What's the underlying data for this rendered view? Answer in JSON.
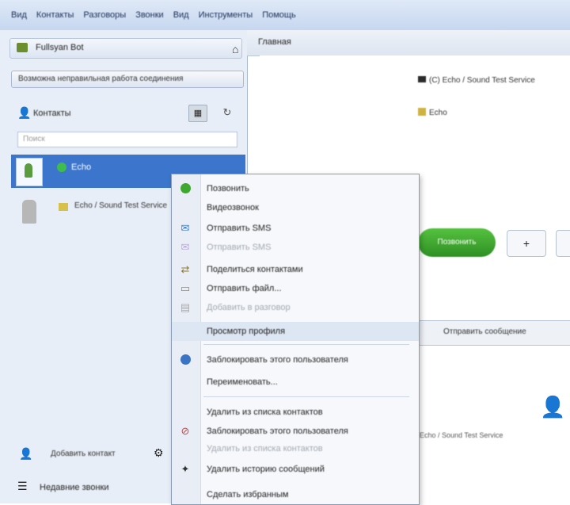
{
  "menubar": {
    "items": [
      "Вид",
      "Контакты",
      "Разговоры",
      "Звонки",
      "Вид",
      "Инструменты",
      "Помощь"
    ]
  },
  "left_panel": {
    "account_label": "Fullsyan Bot",
    "status_text": "Возможна неправильная работа соединения",
    "contacts_label": "Контакты",
    "search_placeholder": "Поиск",
    "selected_contact": "Echo",
    "second_contact": "Echo / Sound Test Service",
    "bottom_item1": "Добавить контакт",
    "bottom_item2": "Недавние звонки"
  },
  "right_panel": {
    "tab_label": "Главная",
    "conv_line1": "(C) Echo / Sound Test Service",
    "conv_line2": "Echo",
    "call_button": "Позвонить",
    "mid_tab": "Отправить сообщение",
    "info_line": "Echo / Sound Test Service"
  },
  "context_menu": {
    "items": [
      {
        "label": "Позвонить",
        "icon": "call-icon",
        "enabled": true
      },
      {
        "label": "Видеозвонок",
        "icon": "",
        "enabled": true
      },
      {
        "label": "Отправить SMS",
        "icon": "sms-icon",
        "enabled": true
      },
      {
        "label": "Отправить SMS",
        "icon": "sms-icon-2",
        "enabled": false
      },
      {
        "label": "Поделиться контактами",
        "icon": "share-icon",
        "enabled": true
      },
      {
        "label": "Отправить файл...",
        "icon": "file-icon",
        "enabled": true
      },
      {
        "label": "Добавить в разговор",
        "icon": "add-icon",
        "enabled": false
      },
      {
        "label": "Просмотр профиля",
        "icon": "",
        "enabled": true,
        "highlighted": true
      },
      {
        "label": "Заблокировать этого пользователя",
        "icon": "block-icon",
        "enabled": true
      },
      {
        "label": "Переименовать...",
        "icon": "",
        "enabled": true
      },
      {
        "label": "Удалить из списка контактов",
        "icon": "",
        "enabled": true
      },
      {
        "label": "Заблокировать этого пользователя",
        "icon": "block-red-icon",
        "enabled": true
      },
      {
        "label": "Удалить из списка контактов",
        "icon": "",
        "enabled": false
      },
      {
        "label": "Удалить историю сообщений",
        "icon": "",
        "enabled": true
      },
      {
        "label": "Сделать избранным",
        "icon": "",
        "enabled": true
      }
    ]
  },
  "colors": {
    "selected_row": "#3b76cc",
    "online_green": "#3ebc4c",
    "call_green": "#3da82e"
  }
}
